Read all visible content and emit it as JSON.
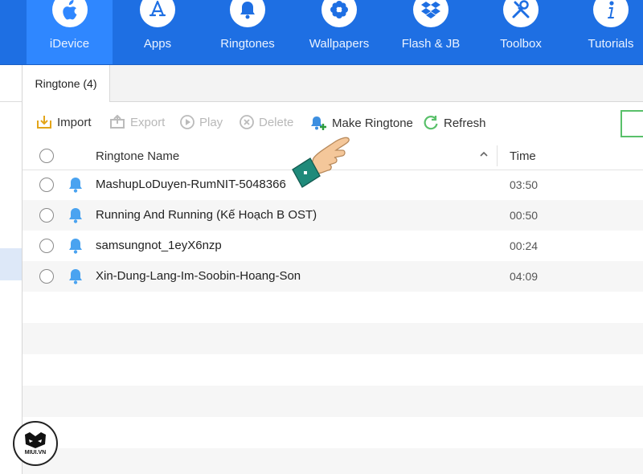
{
  "nav": {
    "items": [
      {
        "label": "iDevice",
        "icon": "apple-icon",
        "active": true
      },
      {
        "label": "Apps",
        "icon": "app-store-icon"
      },
      {
        "label": "Ringtones",
        "icon": "bell-icon"
      },
      {
        "label": "Wallpapers",
        "icon": "flower-icon"
      },
      {
        "label": "Flash & JB",
        "icon": "dropbox-icon"
      },
      {
        "label": "Toolbox",
        "icon": "tools-icon"
      },
      {
        "label": "Tutorials",
        "icon": "info-icon"
      }
    ]
  },
  "tab": {
    "label": "Ringtone (4)"
  },
  "toolbar": {
    "import_label": "Import",
    "export_label": "Export",
    "play_label": "Play",
    "delete_label": "Delete",
    "make_ringtone_label": "Make Ringtone",
    "refresh_label": "Refresh"
  },
  "table": {
    "col_name": "Ringtone Name",
    "col_time": "Time",
    "rows": [
      {
        "name": "MashupLoDuyen-RumNIT-5048366",
        "time": "03:50"
      },
      {
        "name": "Running And Running (Kế Hoạch B OST)",
        "time": "00:50"
      },
      {
        "name": "samsungnot_1eyX6nzp",
        "time": "00:24"
      },
      {
        "name": "Xin-Dung-Lang-Im-Soobin-Hoang-Son",
        "time": "04:09"
      }
    ]
  },
  "watermark": {
    "text": "MIUI.VN"
  },
  "colors": {
    "header_blue": "#1e6fe3",
    "active_blue": "#2f87ff",
    "bell_blue": "#4aa3f0",
    "refresh_green": "#59c06a"
  }
}
